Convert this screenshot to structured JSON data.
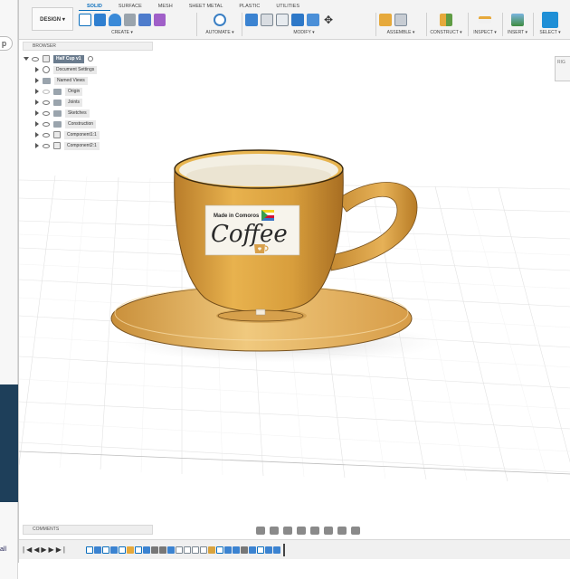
{
  "left_strip": {
    "tab_letter": "p",
    "bottom_text": "all"
  },
  "toolbar": {
    "workspace_button": "DESIGN",
    "tabs": [
      "SOLID",
      "SURFACE",
      "MESH",
      "SHEET METAL",
      "PLASTIC",
      "UTILITIES"
    ],
    "active_tab": "SOLID",
    "groups": [
      "CREATE",
      "AUTOMATE",
      "MODIFY",
      "ASSEMBLE",
      "CONSTRUCT",
      "INSPECT",
      "INSERT",
      "SELECT"
    ]
  },
  "browser": {
    "title": "BROWSER",
    "root": "Half Cup v1",
    "items": [
      "Document Settings",
      "Named Views",
      "Origin",
      "Joints",
      "Sketches",
      "Construction",
      "Component1:1",
      "Component2:1"
    ]
  },
  "decal": {
    "line1": "Made in Comoros",
    "line2": "Coffee"
  },
  "viewcube_label": "RIG",
  "comments_label": "COMMENTS",
  "colors": {
    "accent": "#0a6ebd",
    "cup": "#dba23d",
    "saucer": "#e2ad54",
    "select": "#1f8fd6",
    "decal_text": "#2a2a2a"
  }
}
